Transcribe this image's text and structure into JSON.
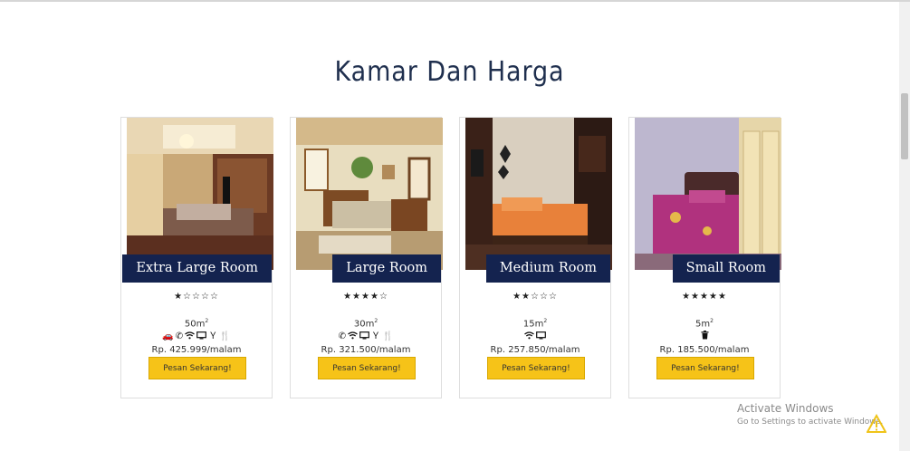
{
  "section": {
    "title": "Kamar Dan Harga"
  },
  "rooms": [
    {
      "name": "Extra Large Room",
      "stars": "★☆☆☆☆",
      "rating": 1,
      "size": "50m",
      "size_sup": "2",
      "facilities": [
        "car-icon",
        "phone-icon",
        "wifi-icon",
        "tv-icon",
        "drink-icon",
        "dining-icon"
      ],
      "price": "Rp. 425.999/malam",
      "button": "Pesan Sekarang!"
    },
    {
      "name": "Large Room",
      "stars": "★★★★☆",
      "rating": 4,
      "size": "30m",
      "size_sup": "2",
      "facilities": [
        "phone-icon",
        "wifi-icon",
        "tv-icon",
        "drink-icon",
        "dining-icon"
      ],
      "price": "Rp. 321.500/malam",
      "button": "Pesan Sekarang!"
    },
    {
      "name": "Medium Room",
      "stars": "★★☆☆☆",
      "rating": 2,
      "size": "15m",
      "size_sup": "2",
      "facilities": [
        "wifi-icon",
        "tv-icon"
      ],
      "price": "Rp. 257.850/malam",
      "button": "Pesan Sekarang!"
    },
    {
      "name": "Small Room",
      "stars": "★★★★★",
      "rating": 5,
      "size": "5m",
      "size_sup": "2",
      "facilities": [
        "trash-icon"
      ],
      "price": "Rp. 185.500/malam",
      "button": "Pesan Sekarang!"
    }
  ],
  "watermark": {
    "line1": "Activate Windows",
    "line2": "Go to Settings to activate Windows."
  },
  "colors": {
    "heading": "#1f2f4e",
    "tag_bg": "#14234f",
    "button_bg": "#f6c318"
  }
}
